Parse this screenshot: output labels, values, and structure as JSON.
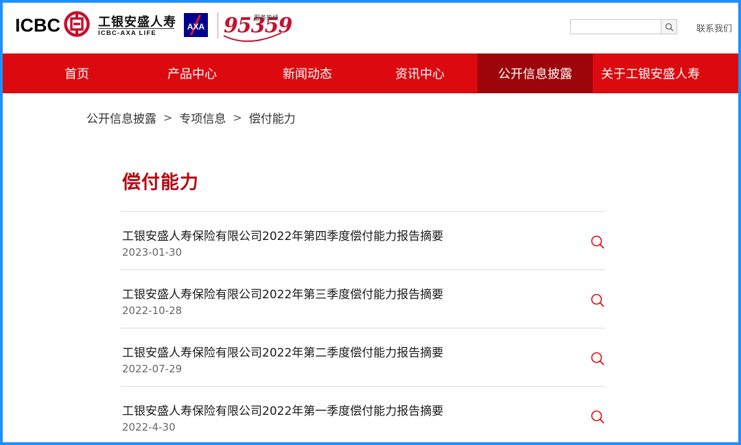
{
  "header": {
    "logo_text": "ICBC",
    "brand_cn": "工银安盛人寿",
    "brand_en": "ICBC-AXA LIFE",
    "axa_text": "AXA",
    "hotline_label": "服务热线",
    "hotline_number": "95359",
    "search_placeholder": "",
    "contact_label": "联系我们"
  },
  "nav": {
    "items": [
      {
        "label": "首页"
      },
      {
        "label": "产品中心"
      },
      {
        "label": "新闻动态"
      },
      {
        "label": "资讯中心"
      },
      {
        "label": "公开信息披露"
      },
      {
        "label": "关于工银安盛人寿"
      }
    ],
    "active_index": 4
  },
  "breadcrumb": {
    "items": [
      "公开信息披露",
      "专项信息",
      "偿付能力"
    ],
    "separator": ">"
  },
  "main": {
    "title": "偿付能力",
    "list": [
      {
        "title": "工银安盛人寿保险有限公司2022年第四季度偿付能力报告摘要",
        "date": "2023-01-30"
      },
      {
        "title": "工银安盛人寿保险有限公司2022年第三季度偿付能力报告摘要",
        "date": "2022-10-28"
      },
      {
        "title": "工银安盛人寿保险有限公司2022年第二季度偿付能力报告摘要",
        "date": "2022-07-29"
      },
      {
        "title": "工银安盛人寿保险有限公司2022年第一季度偿付能力报告摘要",
        "date": "2022-4-30"
      }
    ]
  },
  "colors": {
    "brand_red": "#dc0a0f",
    "active_nav": "#9e050a",
    "title_red": "#b50a12",
    "axa_blue": "#00008f",
    "frame_blue": "#1e90ff"
  },
  "icons": {
    "search": "search-icon",
    "list_item": "search-icon",
    "emblem": "icbc-emblem-icon"
  }
}
